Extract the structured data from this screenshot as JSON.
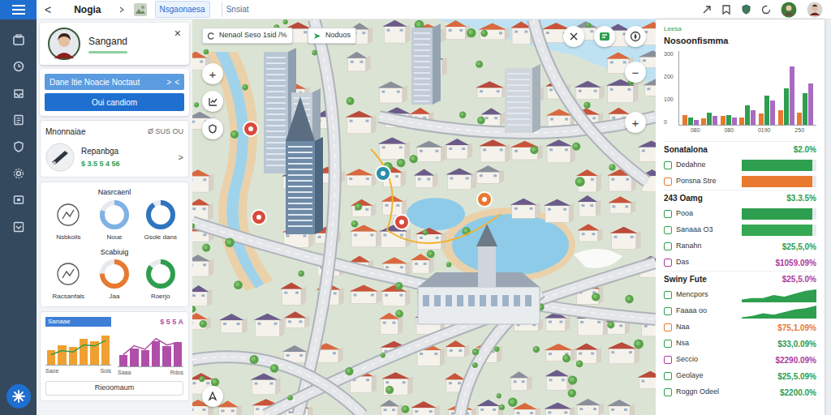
{
  "topbar": {
    "back": "<",
    "title": "Nogia",
    "tabs": [
      {
        "label": "Nsgaonaesa",
        "selected": true
      },
      {
        "label": "Snsiat",
        "selected": false
      }
    ]
  },
  "profile": {
    "name": "Sangand",
    "close": "×"
  },
  "banner": {
    "title": "Dane Itie Noacie Noctaut",
    "actions": [
      ">",
      "<"
    ],
    "button": "Oui candiom"
  },
  "summary": {
    "title": "Mnonnaiae",
    "meta": "Ø SUS OU",
    "item": {
      "title": "Repanbga",
      "value": "$ 3.5 5 4 56",
      "chevron": ">"
    }
  },
  "rings": {
    "groups": [
      {
        "title": "Nasrcaenl",
        "items": [
          {
            "kind": "icon",
            "label": "Nsbkoils"
          },
          {
            "kind": "donut",
            "label": "Noue",
            "level": 0.8,
            "color": "#7fb2e5"
          },
          {
            "kind": "donut",
            "label": "Gsole dans",
            "level": 0.9,
            "color": "#2f74c0"
          }
        ]
      },
      {
        "title": "Scabiuig",
        "items": [
          {
            "kind": "icon",
            "label": "Racsanfals"
          },
          {
            "kind": "donut",
            "label": "Jaa",
            "level": 0.75,
            "color": "#e8792f"
          },
          {
            "kind": "donut",
            "label": "Roerjo",
            "level": 0.85,
            "color": "#2e9e4f"
          }
        ]
      }
    ]
  },
  "mini_charts": [
    {
      "title": "Sanaae",
      "labels": [
        "Saoe",
        "Sols"
      ],
      "series": [
        {
          "type": "bar",
          "color": "#f0a030",
          "values": [
            40,
            55,
            50,
            72,
            65,
            82
          ]
        },
        {
          "type": "line",
          "color": "#2e9e4f",
          "values": [
            30,
            42,
            38,
            58,
            55,
            70
          ]
        }
      ]
    },
    {
      "title": "$ 5 5 A",
      "labels": [
        "Saaa",
        "Rdos"
      ],
      "series": [
        {
          "type": "bar",
          "color": "#b04fa8",
          "values": [
            30,
            50,
            44,
            70,
            55,
            66
          ]
        },
        {
          "type": "line",
          "color": "#b04fa8",
          "values": [
            35,
            60,
            50,
            80,
            62,
            70
          ]
        }
      ]
    }
  ],
  "left_footer": "Rieoomaum",
  "map": {
    "search": "Nenaol Seso 1sid /%",
    "filter": "Noduos",
    "zoom_in": "+",
    "zoom_out": "−",
    "add": "+"
  },
  "right_panel": {
    "badge": "Leesa",
    "chart": {
      "title": "Nosoonfismma",
      "y_ticks": [
        "300",
        "200",
        "100",
        "0"
      ],
      "x_ticks": [
        "080",
        "080",
        "0190",
        "250"
      ],
      "series": [
        {
          "color": "#e8792f",
          "values": [
            40,
            25,
            35,
            30,
            45,
            60,
            50
          ]
        },
        {
          "color": "#2e9e4f",
          "values": [
            30,
            50,
            40,
            80,
            120,
            150,
            130
          ]
        },
        {
          "color": "#a86bc0",
          "values": [
            20,
            35,
            30,
            60,
            100,
            240,
            170
          ]
        }
      ]
    },
    "sections": [
      {
        "title": "Sonatalona",
        "value": "$2.0%",
        "color": "#2e9e4f",
        "rows": [
          {
            "kind": "bar",
            "label": "Dedahne",
            "level": 0.95,
            "color": "#2e9e4f"
          },
          {
            "kind": "bar",
            "label": "Ponsna Stre",
            "level": 0.95,
            "color": "#e8792f"
          }
        ]
      },
      {
        "title": "243 Oamg",
        "value": "$3.3.5%",
        "color": "#2e9e4f",
        "rows": [
          {
            "kind": "bar",
            "label": "Pooa",
            "level": 0.95,
            "color": "#2e9e4f"
          },
          {
            "kind": "bar",
            "label": "Sanaaa O3",
            "level": 0.95,
            "color": "#34a853"
          },
          {
            "kind": "value",
            "label": "Ranahn",
            "value": "$25,5,0%",
            "color": "#2e9e4f"
          },
          {
            "kind": "value",
            "label": "Das",
            "value": "$1059.09%",
            "color": "#b03a9e"
          }
        ]
      },
      {
        "title": "Swiny Fute",
        "value": "$25,5.0%",
        "color": "#b03a9e",
        "rows": [
          {
            "kind": "area",
            "label": "Mencpors",
            "values": [
              2,
              3,
              3,
              5,
              4,
              6,
              8,
              9
            ],
            "color": "#2e9e4f"
          },
          {
            "kind": "area",
            "label": "Faaaa oo",
            "values": [
              1,
              2,
              4,
              3,
              5,
              7,
              8,
              10
            ],
            "color": "#2e9e4f"
          },
          {
            "kind": "value",
            "label": "Naa",
            "value": "$75,1.09%",
            "color": "#e8792f"
          },
          {
            "kind": "value",
            "label": "Nsa",
            "value": "$33,0.09%",
            "color": "#2e9e4f"
          },
          {
            "kind": "value",
            "label": "Seccio",
            "value": "$2290.09%",
            "color": "#b03a9e"
          },
          {
            "kind": "value",
            "label": "Geolaye",
            "value": "$25,5.09%",
            "color": "#2e9e4f"
          },
          {
            "kind": "value",
            "label": "Roggn Odeel",
            "value": "$2200.0%",
            "color": "#2e9e4f"
          }
        ]
      }
    ]
  }
}
